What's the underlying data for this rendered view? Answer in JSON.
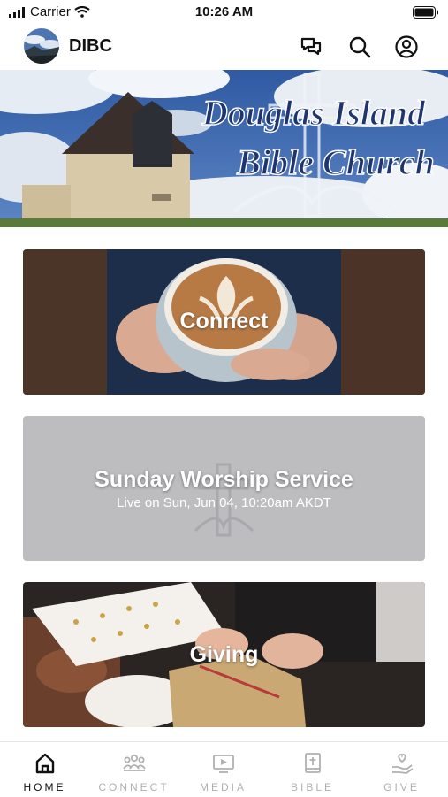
{
  "status_bar": {
    "carrier": "Carrier",
    "time": "10:26 AM"
  },
  "header": {
    "title": "DIBC"
  },
  "hero": {
    "line1": "Douglas Island",
    "line2": "Bible Church"
  },
  "cards": [
    {
      "label": "Connect"
    },
    {
      "label": "Sunday Worship Service",
      "subtitle": "Live on Sun, Jun 04, 10:20am AKDT"
    },
    {
      "label": "Giving"
    }
  ],
  "tabs": [
    {
      "label": "HOME",
      "icon": "home-icon",
      "active": true
    },
    {
      "label": "CONNECT",
      "icon": "people-icon",
      "active": false
    },
    {
      "label": "MEDIA",
      "icon": "media-icon",
      "active": false
    },
    {
      "label": "BIBLE",
      "icon": "bible-icon",
      "active": false
    },
    {
      "label": "GIVE",
      "icon": "give-icon",
      "active": false
    }
  ],
  "colors": {
    "active_tab": "#111111",
    "inactive_tab": "#b0b0b0",
    "live_card_bg": "#bdbdbf"
  }
}
